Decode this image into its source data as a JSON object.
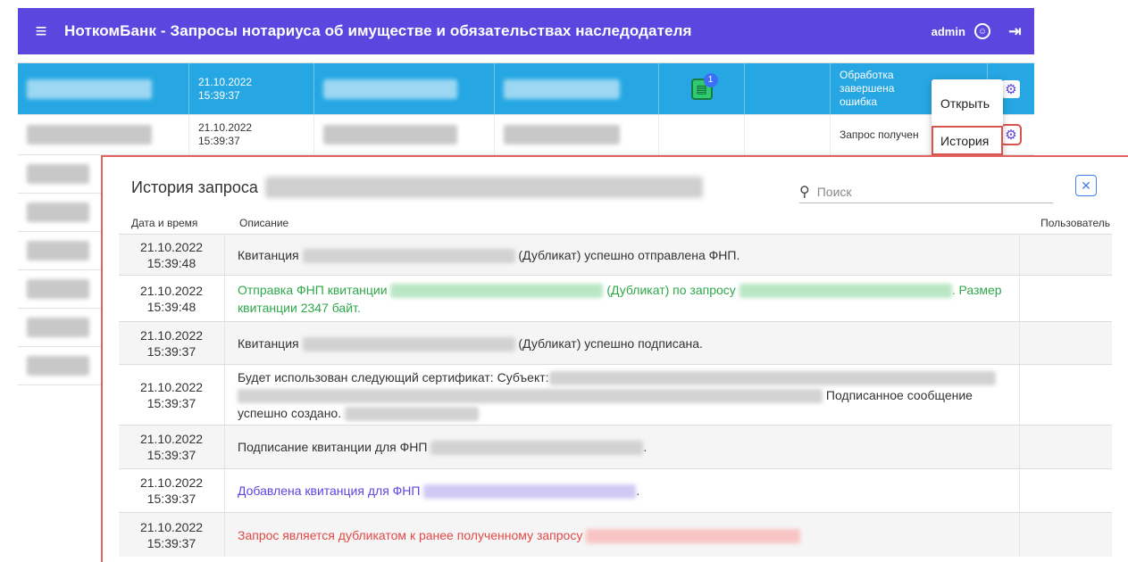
{
  "header": {
    "title": "НоткомБанк - Запросы нотариуса об имуществе и обязательствах наследодателя",
    "user": "admin"
  },
  "table": {
    "selected_row": {
      "date": "21.10.2022",
      "time": "15:39:37",
      "status": "Обработка завершена ошибка",
      "badge_count": "1"
    },
    "second_row": {
      "date": "21.10.2022",
      "time": "15:39:37",
      "status": "Запрос получен"
    }
  },
  "context_menu": {
    "open": "Открыть",
    "history": "История"
  },
  "dialog": {
    "title": "История запроса",
    "search_placeholder": "Поиск",
    "columns": {
      "datetime": "Дата и время",
      "description": "Описание",
      "user": "Пользователь"
    },
    "rows": [
      {
        "date": "21.10.2022",
        "time": "15:39:48",
        "p1": "Квитанция",
        "p2": "(Дубликат) успешно отправлена ФНП.",
        "p3": "",
        "p4": "",
        "p5": "",
        "color": "default"
      },
      {
        "date": "21.10.2022",
        "time": "15:39:48",
        "p1": "Отправка ФНП квитанции",
        "p2": "(Дубликат) по запросу",
        "p3": ". Размер квитанции 2347 байт.",
        "p4": "",
        "p5": "",
        "color": "green"
      },
      {
        "date": "21.10.2022",
        "time": "15:39:37",
        "p1": "Квитанция",
        "p2": "(Дубликат) успешно подписана.",
        "p3": "",
        "p4": "",
        "p5": "",
        "color": "default"
      },
      {
        "date": "21.10.2022",
        "time": "15:39:37",
        "p1": "Будет использован следующий сертификат: Субъект:",
        "p2": "Подписанное сообщение",
        "p3": "успешно создано.",
        "p4": "",
        "p5": "",
        "color": "default"
      },
      {
        "date": "21.10.2022",
        "time": "15:39:37",
        "p1": "Подписание квитанции для ФНП",
        "p2": ".",
        "p3": "",
        "p4": "",
        "p5": "",
        "color": "default"
      },
      {
        "date": "21.10.2022",
        "time": "15:39:37",
        "p1": "Добавлена квитанция для ФНП",
        "p2": ".",
        "p3": "",
        "p4": "",
        "p5": "",
        "color": "purple"
      },
      {
        "date": "21.10.2022",
        "time": "15:39:37",
        "p1": "Запрос является дубликатом к ранее полученному запросу",
        "p2": "",
        "p3": "",
        "p4": "",
        "p5": "",
        "color": "red"
      }
    ]
  },
  "colors": {
    "appbar": "#5b46e0",
    "selected_row": "#26a7e3",
    "highlight_border": "#e06360",
    "green_text": "#2ea84a",
    "purple_text": "#5b46e0",
    "red_text": "#e14a47"
  }
}
